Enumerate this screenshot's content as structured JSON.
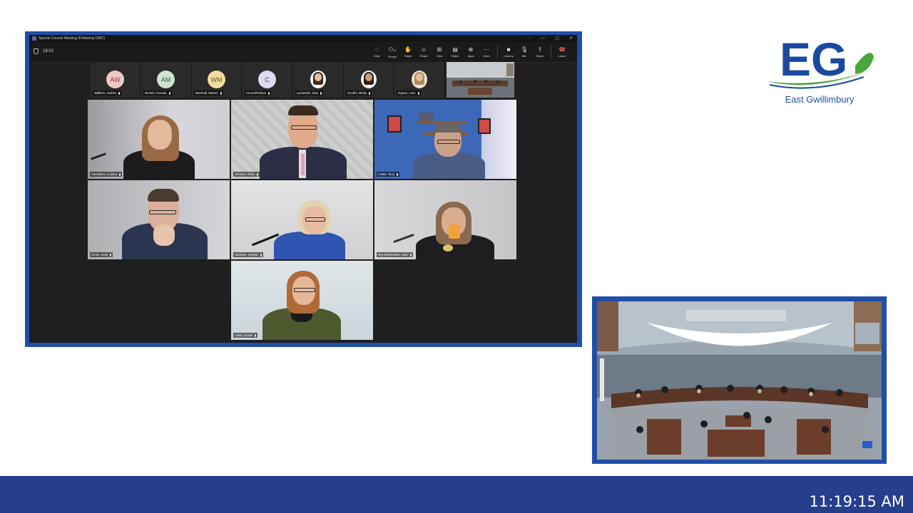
{
  "window": {
    "title": "Special Council Meeting (Following GWC)",
    "timer": "18:01",
    "controls": [
      "···",
      "—",
      "▢",
      "✕"
    ]
  },
  "toolbar": {
    "buttons": [
      {
        "label": "Chat",
        "icon": "chat-icon"
      },
      {
        "label": "People",
        "icon": "people-icon",
        "badge": "11"
      },
      {
        "label": "Raise",
        "icon": "hand-icon"
      },
      {
        "label": "React",
        "icon": "smile-icon"
      },
      {
        "label": "View",
        "icon": "grid-icon"
      },
      {
        "label": "Notes",
        "icon": "notes-icon"
      },
      {
        "label": "Apps",
        "icon": "apps-icon"
      },
      {
        "label": "More",
        "icon": "more-icon"
      },
      {
        "label": "Camera",
        "icon": "camera-icon"
      },
      {
        "label": "Mic",
        "icon": "mic-icon"
      },
      {
        "label": "Share",
        "icon": "share-icon"
      },
      {
        "label": "Leave",
        "icon": "phone-icon"
      }
    ]
  },
  "strip": [
    {
      "initials": "AW",
      "name": "Walkom, Andrew",
      "color": "#f2c7c7",
      "text": "#7a3a3a"
    },
    {
      "initials": "AM",
      "name": "McNeil, Amanda",
      "color": "#cfe3d2",
      "text": "#2f5a3a"
    },
    {
      "initials": "WM",
      "name": "Marshall, Warren",
      "color": "#f3dca0",
      "text": "#6a5520"
    },
    {
      "initials": "C",
      "name": "CouncilPodium",
      "color": "#dcdcee",
      "text": "#40406a"
    },
    {
      "initials": "",
      "name": "Lyonsmith, Sara",
      "color": "#3a2a22",
      "text": ""
    },
    {
      "initials": "",
      "name": "Gundhi, Minita",
      "color": "#2d1e18",
      "text": ""
    },
    {
      "initials": "",
      "name": "Ingram, Lorin",
      "color": "#b08a55",
      "text": ""
    }
  ],
  "tiles": [
    {
      "name": "Carruthers, Loralea"
    },
    {
      "name": "Johnson, Brian"
    },
    {
      "name": "Foster, Terry"
    },
    {
      "name": "Crone, Scott"
    },
    {
      "name": "Hackson, Virginia"
    },
    {
      "name": "Roy-DiClemente, Sara"
    },
    {
      "name": "Lahey, Susan"
    }
  ],
  "logo": {
    "letters": "EG",
    "caption": "East Gwillimbury",
    "brand_blue": "#1a4aa0",
    "brand_green": "#4aa63a"
  },
  "footer": {
    "clock": "11:19:15 AM"
  }
}
